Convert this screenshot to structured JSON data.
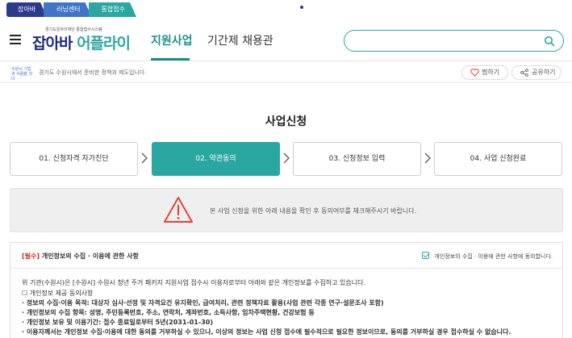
{
  "topbar": {
    "tabs": [
      "잡아바",
      "러닝센터",
      "통합접수"
    ]
  },
  "header": {
    "logo_sub": "경기도일자리재단 통합접수시스템",
    "logo_main_a": "잡아바 ",
    "logo_main_b": "어플라이",
    "nav": [
      "지원사업",
      "기간제 채용관"
    ],
    "search": {
      "value": "",
      "placeholder": ""
    }
  },
  "infobar": {
    "small_logo": "수원시 기업과 사람을 잇다",
    "crumb": "경기도 수원시에서 준비한 정책과 제도입니다.",
    "like_label": "찜하기",
    "share_label": "공유하기"
  },
  "page": {
    "title": "사업신청"
  },
  "steps": [
    {
      "label": "01. 신청자격 자가진단",
      "active": false
    },
    {
      "label": "02. 약관동의",
      "active": true
    },
    {
      "label": "03. 신청정보 입력",
      "active": false
    },
    {
      "label": "04. 사업 신청완료",
      "active": false
    }
  ],
  "notice": {
    "text": "본 사업 신청을 위한 아래 내용을 확인 후 동의여부를 체크해주시기 바랍니다."
  },
  "consent": {
    "required_tag": "[필수]",
    "title": " 개인정보의 수집 · 이용에 관한 사항",
    "agree_label": "개인정보의 수집 · 이용에 관한 사항에 동의합니다.",
    "agreed": true,
    "lines": [
      {
        "text": "위 기관(수원시)은 [수원시] 수원시 청년 주거 패키지 지원사업 접수시 이용자로부터 아래와 같은 개인정보를 수집하고 있습니다.",
        "bold": false
      },
      {
        "text": "☐ 개인정보 제공 동의사항",
        "bold": false
      },
      {
        "text": "· 정보의 수집·이용 목적: 대상자 심사·선정 및 자격요건 유지확인, 급여처리, 관련 정책자료 활용(사업 관련 각종 연구·설문조사 포함)",
        "bold": true
      },
      {
        "text": "· 개인정보의 수집 항목: 성명, 주민등록번호, 주소, 연락처, 계좌번호, 소득사항, 임차주택현황, 건강보험 등",
        "bold": true
      },
      {
        "text": "· 개인정보 보유 및 이용기간: 접수 종료일로부터 5년(2031-01-30)",
        "bold": true
      },
      {
        "text": "· 이용자께서는 개인정보 수집·이용에 대한 동의를 거부하실 수 있으나, 이상의 정보는 사업 신청 접수에 필수적으로 필요한 정보이므로, 동의를 거부하실 경우 접수하실 수 없습니다.",
        "bold": true
      }
    ]
  },
  "colors": {
    "teal": "#2aa7a0",
    "navy": "#2c3a8c",
    "blue": "#3f74c6",
    "warning": "#e0453b",
    "required": "#d9261c"
  }
}
